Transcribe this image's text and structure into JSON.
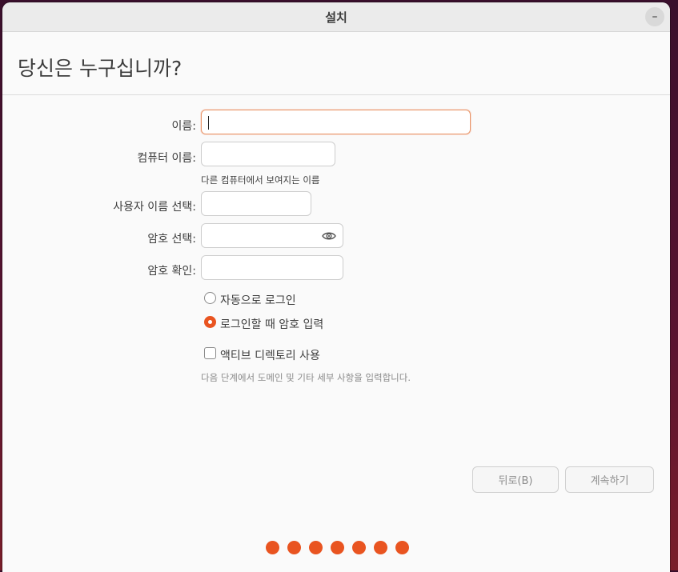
{
  "window": {
    "title": "설치",
    "minimize_glyph": "–"
  },
  "header": {
    "heading": "당신은 누구십니까?"
  },
  "form": {
    "name_label": "이름:",
    "name_value": "",
    "computer_label": "컴퓨터 이름:",
    "computer_value": "",
    "computer_hint": "다른 컴퓨터에서 보여지는 이름",
    "username_label": "사용자 이름 선택:",
    "username_value": "",
    "password_label": "암호 선택:",
    "password_value": "",
    "confirm_label": "암호 확인:",
    "confirm_value": "",
    "reveal_icon": "eye-icon"
  },
  "login_options": {
    "auto_login_label": "자동으로 로그인",
    "require_password_label": "로그인할 때 암호 입력",
    "selected": "require_password"
  },
  "active_directory": {
    "label": "액티브 디렉토리 사용",
    "checked": false,
    "note": "다음 단계에서 도메인 및 기타 세부 사항을 입력합니다."
  },
  "buttons": {
    "back_label": "뒤로(B)",
    "continue_label": "계속하기"
  },
  "progress": {
    "steps": 7
  },
  "colors": {
    "accent": "#e95420",
    "focus_border": "#e9966a"
  }
}
